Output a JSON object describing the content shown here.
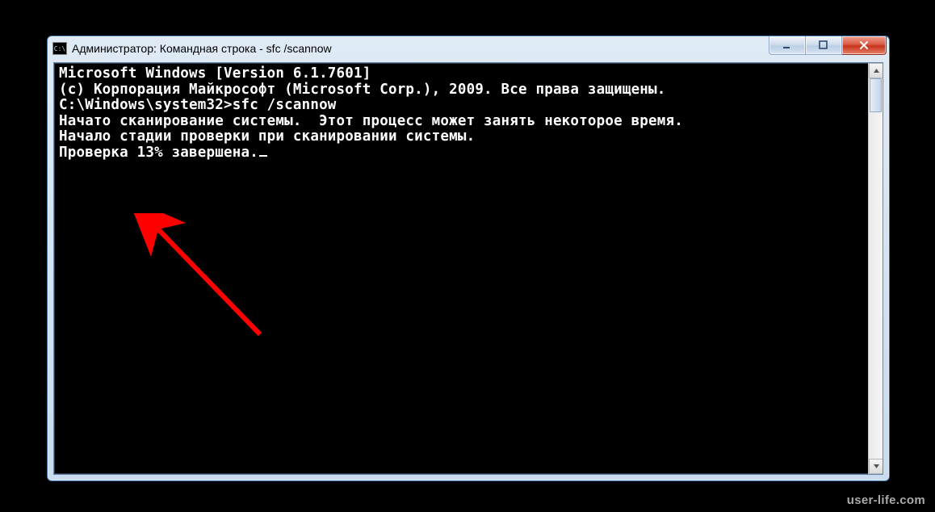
{
  "window": {
    "title": "Администратор: Командная строка - sfc  /scannow",
    "icon_label": "C:\\"
  },
  "caption": {
    "minimize": "Minimize",
    "maximize": "Maximize",
    "close": "Close"
  },
  "console": {
    "lines": [
      "Microsoft Windows [Version 6.1.7601]",
      "(c) Корпорация Майкрософт (Microsoft Corp.), 2009. Все права защищены.",
      "",
      "C:\\Windows\\system32>sfc /scannow",
      "",
      "Начато сканирование системы.  Этот процесс может занять некоторое время.",
      "",
      "Начало стадии проверки при сканировании системы.",
      "Проверка 13% завершена."
    ]
  },
  "watermark": "user-life.com"
}
